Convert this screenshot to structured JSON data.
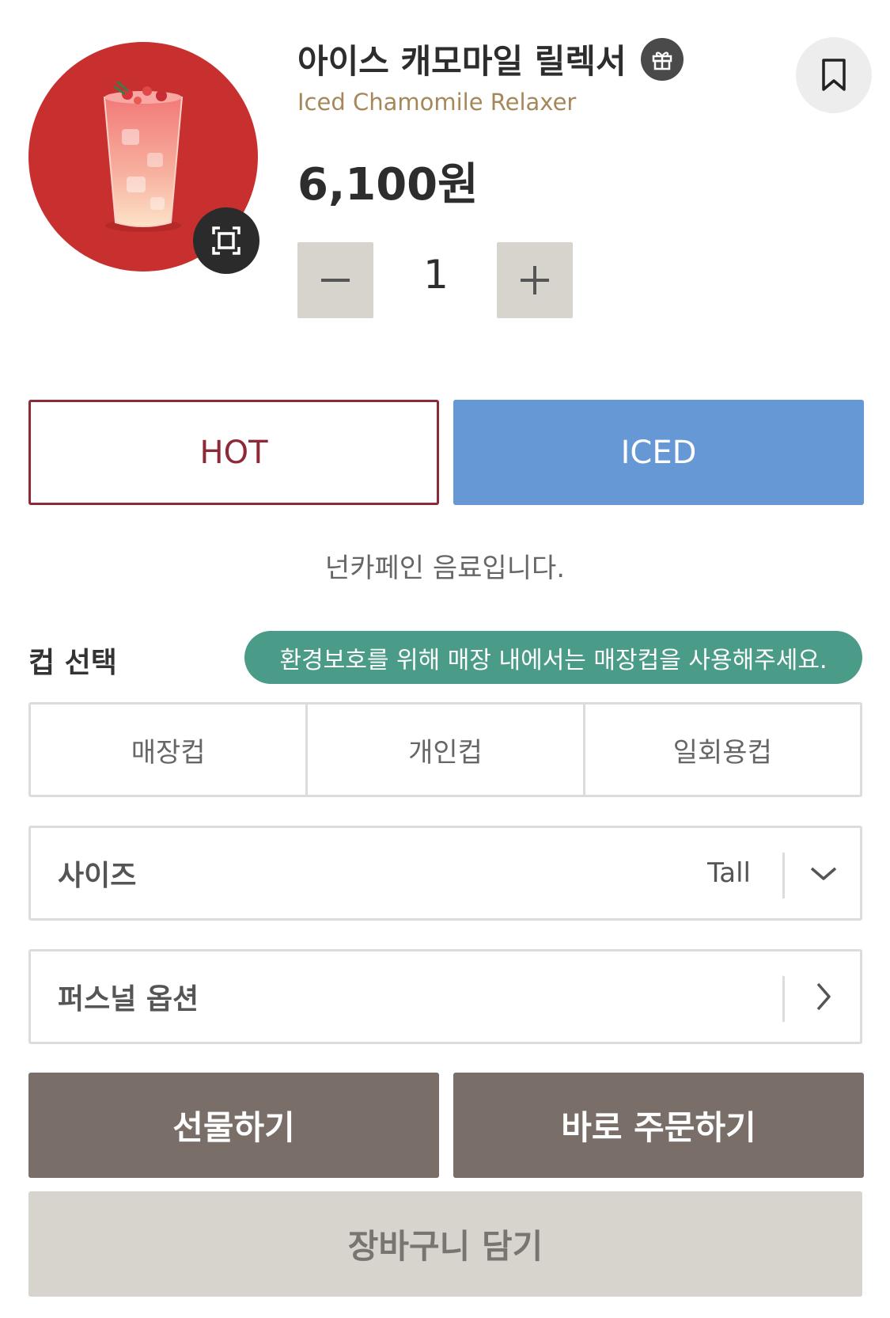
{
  "product": {
    "name_ko": "아이스 캐모마일 릴렉서",
    "name_en": "Iced Chamomile Relaxer",
    "price": "6,100원",
    "image_bg_color": "#c8302f",
    "icons": {
      "gift": "gift-icon",
      "bookmark": "bookmark-icon",
      "zoom": "expand-icon"
    }
  },
  "quantity": {
    "value": "1",
    "minus_icon": "minus-icon",
    "plus_icon": "plus-icon"
  },
  "temperature": {
    "hot_label": "HOT",
    "iced_label": "ICED",
    "selected": "ICED",
    "hot_color": "#8e2a38",
    "iced_color": "#6598d4"
  },
  "caffeine_note": "넌카페인 음료입니다.",
  "cup": {
    "label": "컵 선택",
    "eco_message": "환경보호를 위해 매장 내에서는 매장컵을 사용해주세요.",
    "eco_color": "#4a9b87",
    "options": [
      "매장컵",
      "개인컵",
      "일회용컵"
    ]
  },
  "size": {
    "label": "사이즈",
    "value": "Tall",
    "icon": "chevron-down-icon"
  },
  "personal_option": {
    "label": "퍼스널 옵션",
    "icon": "chevron-right-icon"
  },
  "actions": {
    "gift": "선물하기",
    "order_now": "바로 주문하기",
    "add_to_cart": "장바구니 담기",
    "primary_color": "#7a6e68",
    "secondary_color": "#d7d3cd"
  }
}
